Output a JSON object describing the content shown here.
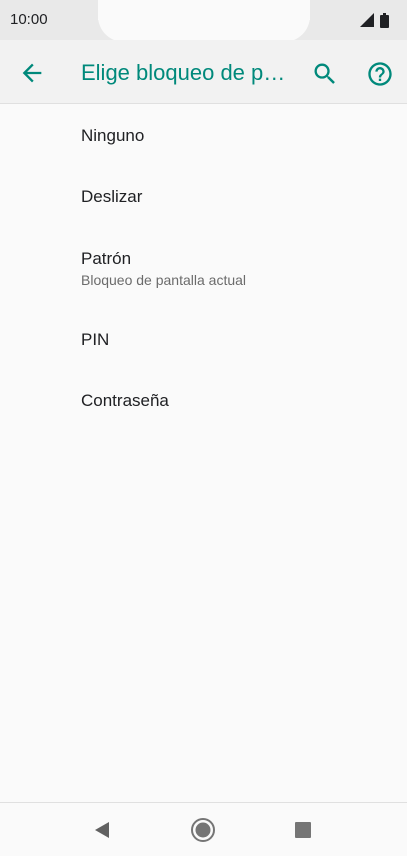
{
  "status_bar": {
    "time": "10:00"
  },
  "app_bar": {
    "title": "Elige bloqueo de p…",
    "accent_color": "#00897b",
    "icons": [
      "back-arrow-icon",
      "search-icon",
      "help-icon"
    ]
  },
  "list": {
    "items": [
      {
        "label": "Ninguno",
        "summary": ""
      },
      {
        "label": "Deslizar",
        "summary": ""
      },
      {
        "label": "Patrón",
        "summary": "Bloqueo de pantalla actual"
      },
      {
        "label": "PIN",
        "summary": ""
      },
      {
        "label": "Contraseña",
        "summary": ""
      }
    ]
  },
  "nav_bar": {
    "icons": [
      "back-triangle-icon",
      "home-circle-icon",
      "recents-square-icon"
    ]
  }
}
